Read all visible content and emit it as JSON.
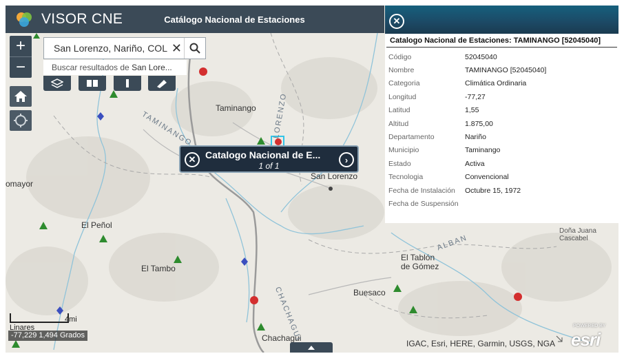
{
  "header": {
    "app_title": "VISOR CNE",
    "subtitle": "Catálogo Nacional de Estaciones"
  },
  "zoom": {
    "in_label": "+",
    "out_label": "−"
  },
  "search": {
    "value": "San Lorenzo, Nariño, COL",
    "suggestion_prefix": "Buscar resultados de ",
    "suggestion_term": "San Lore..."
  },
  "map_labels": {
    "taminango": "Taminango",
    "san_lorenzo": "San Lorenzo",
    "el_penol": "El Peñol",
    "el_tambo": "El Tambo",
    "el_tablon": "El Tablón\nde Gómez",
    "buesaco": "Buesaco",
    "chachagui": "Chachagui",
    "omayor": "omayor",
    "dona_juana": "Doña Juana\nCascabel",
    "road_taminango": "TAMINANGO",
    "road_lorenzo": "LORENZO",
    "road_chachagui": "CHACHAGUI",
    "road_alban": "ALBAN"
  },
  "popup": {
    "title": "Catalogo Nacional de E...",
    "counter": "1 of 1"
  },
  "panel": {
    "title": "Catalogo Nacional de Estaciones: TAMINANGO [52045040]",
    "rows": [
      {
        "key": "Código",
        "value": "52045040"
      },
      {
        "key": "Nombre",
        "value": "TAMINANGO [52045040]"
      },
      {
        "key": "Categoria",
        "value": "Climática Ordinaria"
      },
      {
        "key": "Longitud",
        "value": "-77,27"
      },
      {
        "key": "Latitud",
        "value": "1,55"
      },
      {
        "key": "Altitud",
        "value": "1.875,00"
      },
      {
        "key": "Departamento",
        "value": "Nariño"
      },
      {
        "key": "Municipio",
        "value": "Taminango"
      },
      {
        "key": "Estado",
        "value": "Activa"
      },
      {
        "key": "Tecnologia",
        "value": "Convencional"
      },
      {
        "key": "Fecha de Instalación",
        "value": "Octubre 15, 1972"
      },
      {
        "key": "Fecha de Suspensión",
        "value": ""
      }
    ]
  },
  "scale": {
    "left_label": "Linares",
    "right_label": "4mi"
  },
  "coordinates": "-77,229 1,494 Grados",
  "attribution": "IGAC, Esri, HERE, Garmin, USGS, NGA",
  "esri_logo": "esri",
  "esri_powered": "POWERED BY",
  "icons": [
    "layers-icon",
    "basemap-icon",
    "legend-icon",
    "measure-icon",
    "home-icon",
    "locate-icon",
    "search-icon",
    "close-icon",
    "next-icon",
    "station-icon"
  ],
  "colors": {
    "bar": "#3b4a57",
    "popup": "#1f2d3d",
    "panel_head": "#1c4965",
    "station_green": "#2e8b2e",
    "station_red": "#d32f2f",
    "station_blue": "#3b4fbf"
  }
}
